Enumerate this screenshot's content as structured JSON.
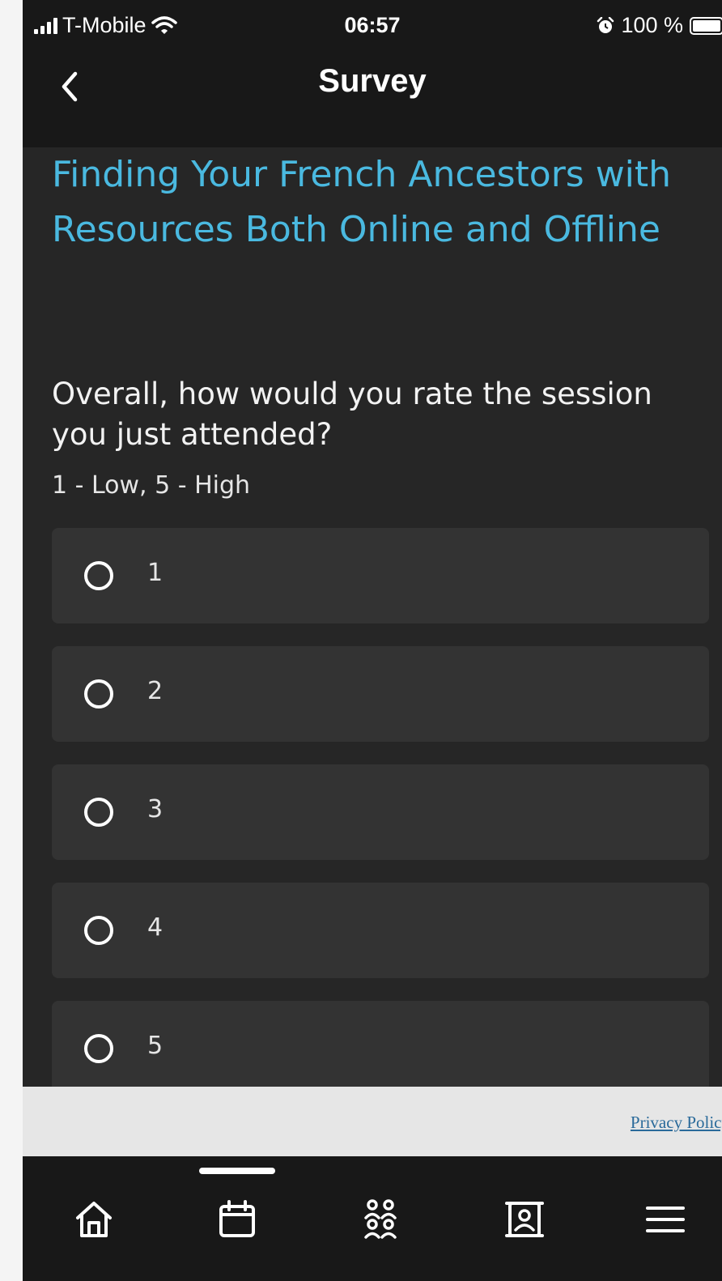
{
  "status_bar": {
    "carrier": "T-Mobile",
    "time": "06:57",
    "battery": "100 %"
  },
  "nav": {
    "title": "Survey",
    "back_icon": "chevron-left-icon"
  },
  "survey": {
    "session_title": "Finding Your French Ancestors with Resources Both Online and Offline",
    "question": "Overall, how would you rate the session you just attended?",
    "scale_hint": "1 - Low, 5 - High",
    "options": [
      {
        "label": "1"
      },
      {
        "label": "2"
      },
      {
        "label": "3"
      },
      {
        "label": "4"
      },
      {
        "label": "5"
      }
    ]
  },
  "footer": {
    "privacy_label": "Privacy Policy"
  },
  "tab_bar": {
    "tabs": [
      {
        "icon": "home-icon"
      },
      {
        "icon": "calendar-icon"
      },
      {
        "icon": "people-icon"
      },
      {
        "icon": "contact-card-icon"
      },
      {
        "icon": "menu-icon"
      }
    ],
    "active": "calendar-icon"
  },
  "colors": {
    "accent": "#4ab9e0",
    "background": "#262626",
    "option_background": "#333333",
    "bar_background": "#181818",
    "footer_background": "#e6e6e6",
    "link": "#2a6a9a"
  }
}
